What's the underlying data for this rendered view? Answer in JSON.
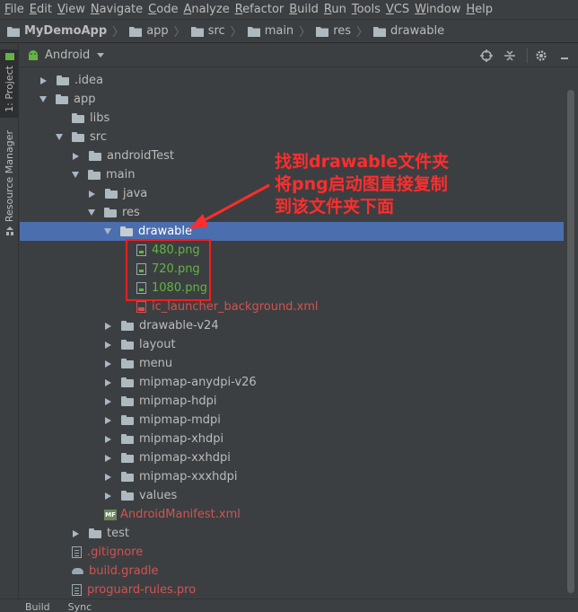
{
  "menubar": {
    "items": [
      "File",
      "Edit",
      "View",
      "Navigate",
      "Code",
      "Analyze",
      "Refactor",
      "Build",
      "Run",
      "Tools",
      "VCS",
      "Window",
      "Help"
    ]
  },
  "breadcrumb": {
    "items": [
      "MyDemoApp",
      "app",
      "src",
      "main",
      "res",
      "drawable"
    ]
  },
  "leftstrip": {
    "project_tab": "1: Project",
    "resource_tab": "Resource Manager"
  },
  "panel": {
    "view_label": "Android"
  },
  "tree": {
    "rows": [
      {
        "label": ".idea",
        "color": "gray"
      },
      {
        "label": "app",
        "color": "gray"
      },
      {
        "label": "libs",
        "color": "gray"
      },
      {
        "label": "src",
        "color": "gray"
      },
      {
        "label": "androidTest",
        "color": "gray"
      },
      {
        "label": "main",
        "color": "gray"
      },
      {
        "label": "java",
        "color": "gray"
      },
      {
        "label": "res",
        "color": "gray"
      },
      {
        "label": "drawable",
        "color": "gray"
      },
      {
        "label": "480.png",
        "color": "green"
      },
      {
        "label": "720.png",
        "color": "green"
      },
      {
        "label": "1080.png",
        "color": "green"
      },
      {
        "label": "ic_launcher_background.xml",
        "color": "red"
      },
      {
        "label": "drawable-v24",
        "color": "gray"
      },
      {
        "label": "layout",
        "color": "gray"
      },
      {
        "label": "menu",
        "color": "gray"
      },
      {
        "label": "mipmap-anydpi-v26",
        "color": "gray"
      },
      {
        "label": "mipmap-hdpi",
        "color": "gray"
      },
      {
        "label": "mipmap-mdpi",
        "color": "gray"
      },
      {
        "label": "mipmap-xhdpi",
        "color": "gray"
      },
      {
        "label": "mipmap-xxhdpi",
        "color": "gray"
      },
      {
        "label": "mipmap-xxxhdpi",
        "color": "gray"
      },
      {
        "label": "values",
        "color": "gray"
      },
      {
        "label": "AndroidManifest.xml",
        "color": "red"
      },
      {
        "label": "test",
        "color": "gray"
      },
      {
        "label": ".gitignore",
        "color": "red"
      },
      {
        "label": "build.gradle",
        "color": "red"
      },
      {
        "label": "proguard-rules.pro",
        "color": "red"
      }
    ],
    "selected_label": "drawable",
    "mf_badge": "MF"
  },
  "bottom": {
    "tabs": [
      "Build",
      "Sync"
    ]
  },
  "annotation": {
    "lines": [
      "找到drawable文件夹",
      "将png启动图直接复制",
      "到该文件夹下面"
    ],
    "color": "#ff2d2d"
  },
  "colors": {
    "background": "#3c3f41",
    "selection": "#4b6eaf",
    "vcs_red": "#d25252",
    "vcs_green": "#62b543"
  }
}
